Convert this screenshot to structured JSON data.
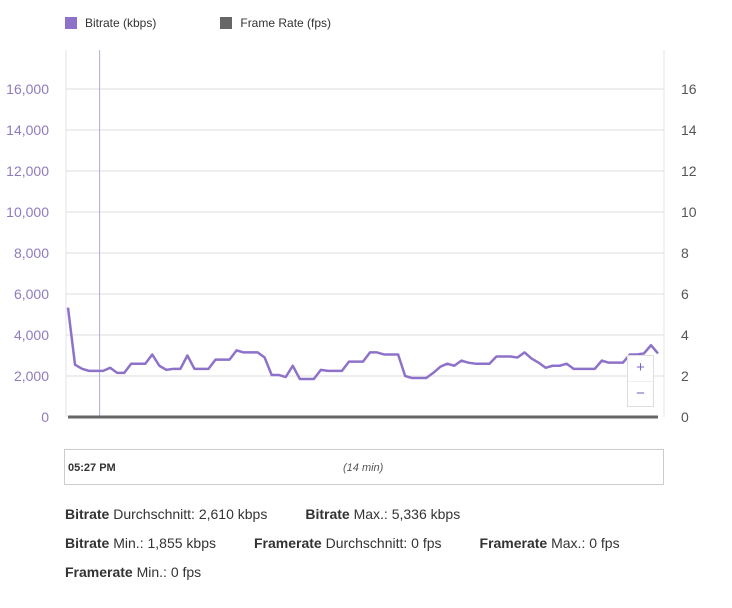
{
  "legend": [
    {
      "label": "Bitrate (kbps)",
      "color": "#8e72c9"
    },
    {
      "label": "Frame Rate (fps)",
      "color": "#666666"
    }
  ],
  "zoom_controls": {
    "zoom_in": "+",
    "zoom_out": "−"
  },
  "timeline": {
    "start_time": "05:27 PM",
    "duration": "(14 min)"
  },
  "stats": [
    [
      {
        "metric": "Bitrate",
        "label": "Durchschnitt: 2,610 kbps"
      },
      {
        "metric": "Bitrate",
        "label": "Max.: 5,336 kbps"
      }
    ],
    [
      {
        "metric": "Bitrate",
        "label": "Min.: 1,855 kbps"
      },
      {
        "metric": "Framerate",
        "label": "Durchschnitt: 0 fps"
      },
      {
        "metric": "Framerate",
        "label": "Max.: 0 fps"
      }
    ],
    [
      {
        "metric": "Framerate",
        "label": "Min.: 0 fps"
      }
    ]
  ],
  "chart_data": {
    "type": "line",
    "title": "",
    "xlabel": "",
    "ylabel": "",
    "grid": true,
    "legend_position": "top-left",
    "y_left": {
      "range": [
        0,
        16000
      ],
      "ticks": [
        "0",
        "2,000",
        "4,000",
        "6,000",
        "8,000",
        "10,000",
        "12,000",
        "14,000",
        "16,000"
      ],
      "tick_values": [
        0,
        2000,
        4000,
        6000,
        8000,
        10000,
        12000,
        14000,
        16000
      ]
    },
    "y_right": {
      "range": [
        0,
        16
      ],
      "ticks": [
        "0",
        "2",
        "4",
        "6",
        "8",
        "10",
        "12",
        "14",
        "16"
      ],
      "tick_values": [
        0,
        2,
        4,
        6,
        8,
        10,
        12,
        14,
        16
      ]
    },
    "x_range_minutes": [
      0,
      14
    ],
    "series": [
      {
        "name": "Bitrate (kbps)",
        "axis": "left",
        "color": "#8e72c9",
        "values": [
          5336,
          2550,
          2350,
          2250,
          2250,
          2250,
          2400,
          2150,
          2150,
          2600,
          2600,
          2600,
          3050,
          2500,
          2300,
          2350,
          2350,
          3000,
          2350,
          2350,
          2350,
          2800,
          2800,
          2800,
          3250,
          3150,
          3150,
          3150,
          2900,
          2050,
          2050,
          1950,
          2500,
          1855,
          1855,
          1855,
          2300,
          2250,
          2250,
          2250,
          2700,
          2700,
          2700,
          3150,
          3150,
          3050,
          3050,
          3050,
          2000,
          1900,
          1900,
          1900,
          2150,
          2450,
          2600,
          2500,
          2750,
          2650,
          2600,
          2600,
          2600,
          2950,
          2950,
          2950,
          2900,
          3150,
          2850,
          2650,
          2400,
          2500,
          2500,
          2600,
          2350,
          2350,
          2350,
          2350,
          2750,
          2650,
          2650,
          2650,
          3050,
          3050,
          3100,
          3500,
          3100
        ]
      },
      {
        "name": "Frame Rate (fps)",
        "axis": "right",
        "color": "#666666",
        "values": [
          0,
          0
        ]
      }
    ],
    "cursor_line_minutes": 0.75
  }
}
